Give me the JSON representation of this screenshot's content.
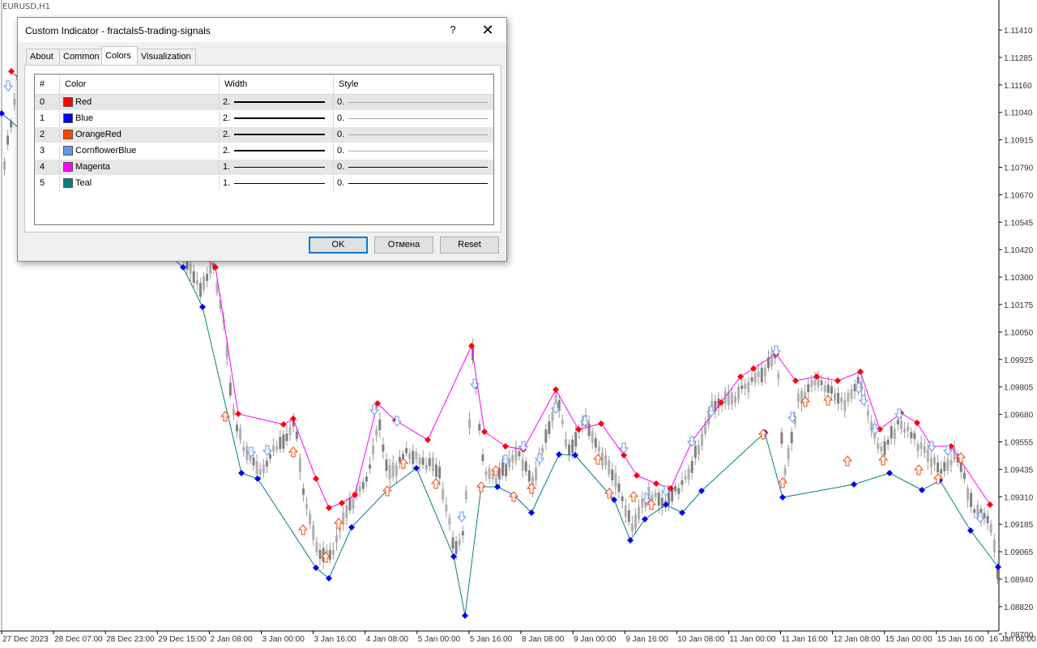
{
  "chart": {
    "symbol": "EURUSD,H1",
    "price_labels": [
      "1.11410",
      "1.11285",
      "1.11160",
      "1.11040",
      "1.10915",
      "1.10790",
      "1.10670",
      "1.10545",
      "1.10420",
      "1.10300",
      "1.10175",
      "1.10050",
      "1.09925",
      "1.09805",
      "1.09680",
      "1.09555",
      "1.09435",
      "1.09310",
      "1.09185",
      "1.09065",
      "1.08940",
      "1.08820",
      "1.08700"
    ],
    "time_labels": [
      "27 Dec 2023",
      "28 Dec 07:00",
      "28 Dec 23:00",
      "29 Dec 15:00",
      "2 Jan 08:00",
      "3 Jan 00:00",
      "3 Jan 16:00",
      "4 Jan 08:00",
      "5 Jan 00:00",
      "5 Jan 16:00",
      "8 Jan 08:00",
      "9 Jan 00:00",
      "9 Jan 16:00",
      "10 Jan 08:00",
      "11 Jan 00:00",
      "11 Jan 16:00",
      "12 Jan 08:00",
      "15 Jan 00:00",
      "15 Jan 16:00",
      "16 Jan 08:00"
    ],
    "colors": {
      "up_fractal": "#ff0000",
      "down_fractal": "#0000ff",
      "zigzag_high": "#ff00ff",
      "zigzag_low": "#008080",
      "candle": "#808080",
      "arrow_up": "#ff4500",
      "arrow_down": "#6495ed"
    }
  },
  "dialog": {
    "title": "Custom Indicator - fractals5-trading-signals",
    "help": "?",
    "close": "✕",
    "tabs": [
      "About",
      "Common",
      "Colors",
      "Visualization"
    ],
    "active_tab": "Colors",
    "columns": [
      "#",
      "Color",
      "Width",
      "Style"
    ],
    "rows": [
      {
        "index": "0",
        "name": "Red",
        "color": "#ff0000",
        "width": "2.",
        "style": "0."
      },
      {
        "index": "1",
        "name": "Blue",
        "color": "#0000ff",
        "width": "2.",
        "style": "0."
      },
      {
        "index": "2",
        "name": "OrangeRed",
        "color": "#ff4500",
        "width": "2.",
        "style": "0."
      },
      {
        "index": "3",
        "name": "CornflowerBlue",
        "color": "#6495ed",
        "width": "2.",
        "style": "0."
      },
      {
        "index": "4",
        "name": "Magenta",
        "color": "#ff00ff",
        "width": "1.",
        "style": "0."
      },
      {
        "index": "5",
        "name": "Teal",
        "color": "#008080",
        "width": "1.",
        "style": "0."
      }
    ],
    "buttons": {
      "ok": "OK",
      "cancel": "Отмена",
      "reset": "Reset"
    }
  }
}
